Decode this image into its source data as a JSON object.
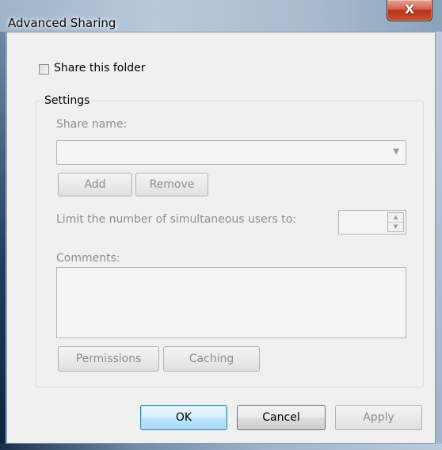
{
  "window": {
    "title": "Advanced Sharing",
    "close_glyph": "X"
  },
  "share": {
    "checkbox_label": "Share this folder",
    "checked": false
  },
  "settings": {
    "group_title": "Settings",
    "share_name_label": "Share name:",
    "share_name_value": "",
    "add_label": "Add",
    "remove_label": "Remove",
    "limit_label": "Limit the number of simultaneous users to:",
    "limit_value": "",
    "comments_label": "Comments:",
    "comments_value": "",
    "permissions_label": "Permissions",
    "caching_label": "Caching"
  },
  "footer": {
    "ok_label": "OK",
    "cancel_label": "Cancel",
    "apply_label": "Apply"
  },
  "icons": {
    "dropdown": "chevron-down-icon",
    "spin_up": "spin-up-icon",
    "spin_down": "spin-down-icon",
    "close": "close-icon"
  }
}
